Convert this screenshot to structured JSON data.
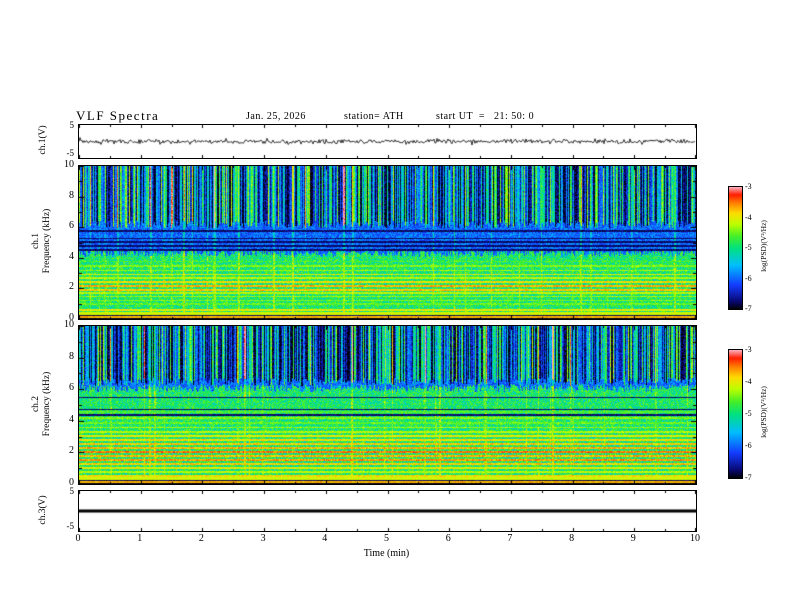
{
  "title": "VLF Spectra",
  "header": {
    "date": "Jan. 25, 2026",
    "station": "station= ATH",
    "start_ut": "start UT  =   21: 50: 0"
  },
  "xaxis": {
    "label": "Time (min)",
    "ticks": [
      "0",
      "1",
      "2",
      "3",
      "4",
      "5",
      "6",
      "7",
      "8",
      "9",
      "10"
    ]
  },
  "colorbar": {
    "label": "log(PSD)(V²/Hz)",
    "ticks": [
      "-3",
      "-4",
      "-5",
      "-6",
      "-7"
    ]
  },
  "panels": {
    "wave1": {
      "label": "ch.1(V)",
      "ytop": "5",
      "ybottom": "-5"
    },
    "spec1": {
      "channel": "ch.1",
      "ylabel": "Frequency (kHz)",
      "yticks": [
        "0",
        "2",
        "4",
        "6",
        "8",
        "10"
      ]
    },
    "spec2": {
      "channel": "ch.2",
      "ylabel": "Frequency (kHz)",
      "yticks": [
        "0",
        "2",
        "4",
        "6",
        "8",
        "10"
      ]
    },
    "wave3": {
      "label": "ch.3(V)",
      "ytop": "5",
      "ybottom": "-5"
    }
  },
  "chart_data": [
    {
      "type": "line",
      "name": "ch1-voltage-waveform",
      "xlabel": "Time (min)",
      "ylabel": "ch.1(V)",
      "xlim": [
        0,
        10
      ],
      "ylim": [
        -5,
        5
      ],
      "description": "broadband noise waveform centered on 0 V, amplitude mostly within ±1 V with occasional sferic spikes"
    },
    {
      "type": "heatmap",
      "name": "ch1-spectrogram",
      "xlabel": "Time (min)",
      "ylabel": "Frequency (kHz)",
      "zlabel": "log(PSD)(V²/Hz)",
      "xlim": [
        0,
        10
      ],
      "ylim": [
        0,
        10
      ],
      "zlim": [
        -7,
        -3
      ],
      "structure": {
        "impulsive_dark_region_khz": [
          6.2,
          10
        ],
        "blue_region_khz": [
          4.35,
          6.2
        ],
        "diffuse_green_region_khz": [
          0.5,
          4.35
        ],
        "harmonic_lines": [
          {
            "f_khz": 0.6,
            "log_psd": -4.0
          },
          {
            "f_khz": 1.0,
            "log_psd": -4.5
          },
          {
            "f_khz": 1.25,
            "log_psd": -4.4
          },
          {
            "f_khz": 1.5,
            "log_psd": -4.3
          },
          {
            "f_khz": 1.75,
            "log_psd": -4.2
          },
          {
            "f_khz": 1.95,
            "log_psd": -3.8
          },
          {
            "f_khz": 2.2,
            "log_psd": -3.7
          },
          {
            "f_khz": 2.45,
            "log_psd": -3.9
          },
          {
            "f_khz": 2.7,
            "log_psd": -4.2
          },
          {
            "f_khz": 2.95,
            "log_psd": -4.0
          },
          {
            "f_khz": 3.2,
            "log_psd": -4.3
          },
          {
            "f_khz": 3.5,
            "log_psd": -4.4
          },
          {
            "f_khz": 3.8,
            "log_psd": -4.6
          }
        ],
        "dark_lines_khz": [
          4.55,
          4.8,
          5.05,
          5.3,
          5.8
        ],
        "bottom_bands": [
          {
            "range_khz": [
              0,
              0.1
            ],
            "log_psd": -7
          },
          {
            "range_khz": [
              0.1,
              0.2
            ],
            "log_psd": -3.7
          },
          {
            "range_khz": [
              0.2,
              0.3
            ],
            "log_psd": -6.8
          },
          {
            "range_khz": [
              0.3,
              0.5
            ],
            "log_psd": -4.1
          }
        ]
      }
    },
    {
      "type": "heatmap",
      "name": "ch2-spectrogram",
      "xlabel": "Time (min)",
      "ylabel": "Frequency (kHz)",
      "zlabel": "log(PSD)(V²/Hz)",
      "xlim": [
        0,
        10
      ],
      "ylim": [
        0,
        10
      ],
      "zlim": [
        -7,
        -3
      ],
      "structure": {
        "impulsive_dark_region_khz": [
          6.5,
          10
        ],
        "blue_region_khz": [
          6.1,
          6.5
        ],
        "diffuse_green_region_khz": [
          0.5,
          6.1
        ],
        "harmonic_lines": [
          {
            "f_khz": 0.55,
            "log_psd": -3.9
          },
          {
            "f_khz": 0.8,
            "log_psd": -4.2
          },
          {
            "f_khz": 1.05,
            "log_psd": -4.0
          },
          {
            "f_khz": 1.3,
            "log_psd": -3.8
          },
          {
            "f_khz": 1.55,
            "log_psd": -3.6
          },
          {
            "f_khz": 1.8,
            "log_psd": -3.7
          },
          {
            "f_khz": 2.05,
            "log_psd": -3.5
          },
          {
            "f_khz": 2.3,
            "log_psd": -3.7
          },
          {
            "f_khz": 2.55,
            "log_psd": -3.8
          },
          {
            "f_khz": 2.8,
            "log_psd": -3.9
          },
          {
            "f_khz": 3.05,
            "log_psd": -4.0
          },
          {
            "f_khz": 3.3,
            "log_psd": -4.2
          },
          {
            "f_khz": 3.6,
            "log_psd": -4.3
          },
          {
            "f_khz": 3.9,
            "log_psd": -4.5
          },
          {
            "f_khz": 4.2,
            "log_psd": -4.4
          },
          {
            "f_khz": 4.6,
            "log_psd": -4.6
          },
          {
            "f_khz": 5.0,
            "log_psd": -4.8
          }
        ],
        "dark_lines_khz": [
          4.4,
          4.75,
          5.5
        ],
        "bottom_bands": [
          {
            "range_khz": [
              0,
              0.1
            ],
            "log_psd": -7
          },
          {
            "range_khz": [
              0.1,
              0.2
            ],
            "log_psd": -3.7
          },
          {
            "range_khz": [
              0.2,
              0.3
            ],
            "log_psd": -6.8
          },
          {
            "range_khz": [
              0.3,
              0.5
            ],
            "log_psd": -4.1
          }
        ]
      }
    },
    {
      "type": "line",
      "name": "ch3-voltage-waveform",
      "xlabel": "Time (min)",
      "ylabel": "ch.3(V)",
      "xlim": [
        0,
        10
      ],
      "ylim": [
        -5,
        5
      ],
      "description": "flat thick line at 0 V (no signal on channel 3)"
    }
  ]
}
